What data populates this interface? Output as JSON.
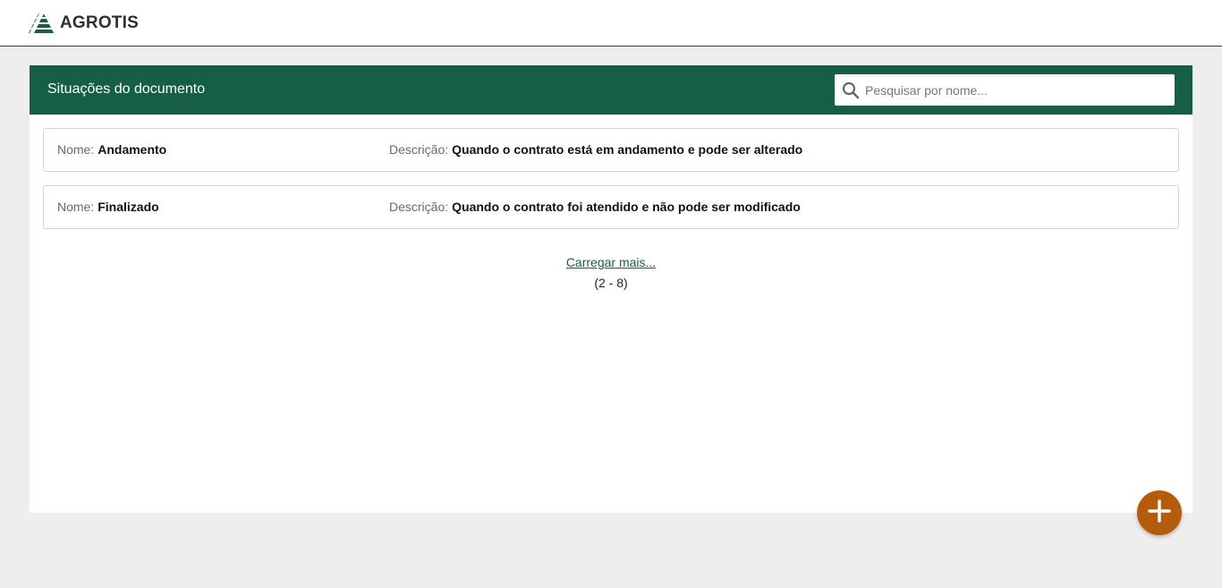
{
  "brand": {
    "name": "AGROTIS",
    "logo_icon": "agrotis-logo-icon"
  },
  "panel": {
    "title": "Situações do documento",
    "search": {
      "value": "",
      "placeholder": "Pesquisar por nome...",
      "icon": "search-icon"
    }
  },
  "items": [
    {
      "name_label": "Nome:",
      "name_value": "Andamento",
      "desc_label": "Descrição:",
      "desc_value": "Quando o contrato está em andamento e pode ser alterado"
    },
    {
      "name_label": "Nome:",
      "name_value": "Finalizado",
      "desc_label": "Descrição:",
      "desc_value": "Quando o contrato foi atendido e não pode ser modificado"
    }
  ],
  "pagination": {
    "load_more_label": "Carregar mais...",
    "count_text": "(2 - 8)"
  },
  "fab": {
    "icon": "plus-icon"
  },
  "colors": {
    "header_green": "#165e45",
    "fab_orange": "#b45c0c",
    "background": "#eeeeee"
  }
}
